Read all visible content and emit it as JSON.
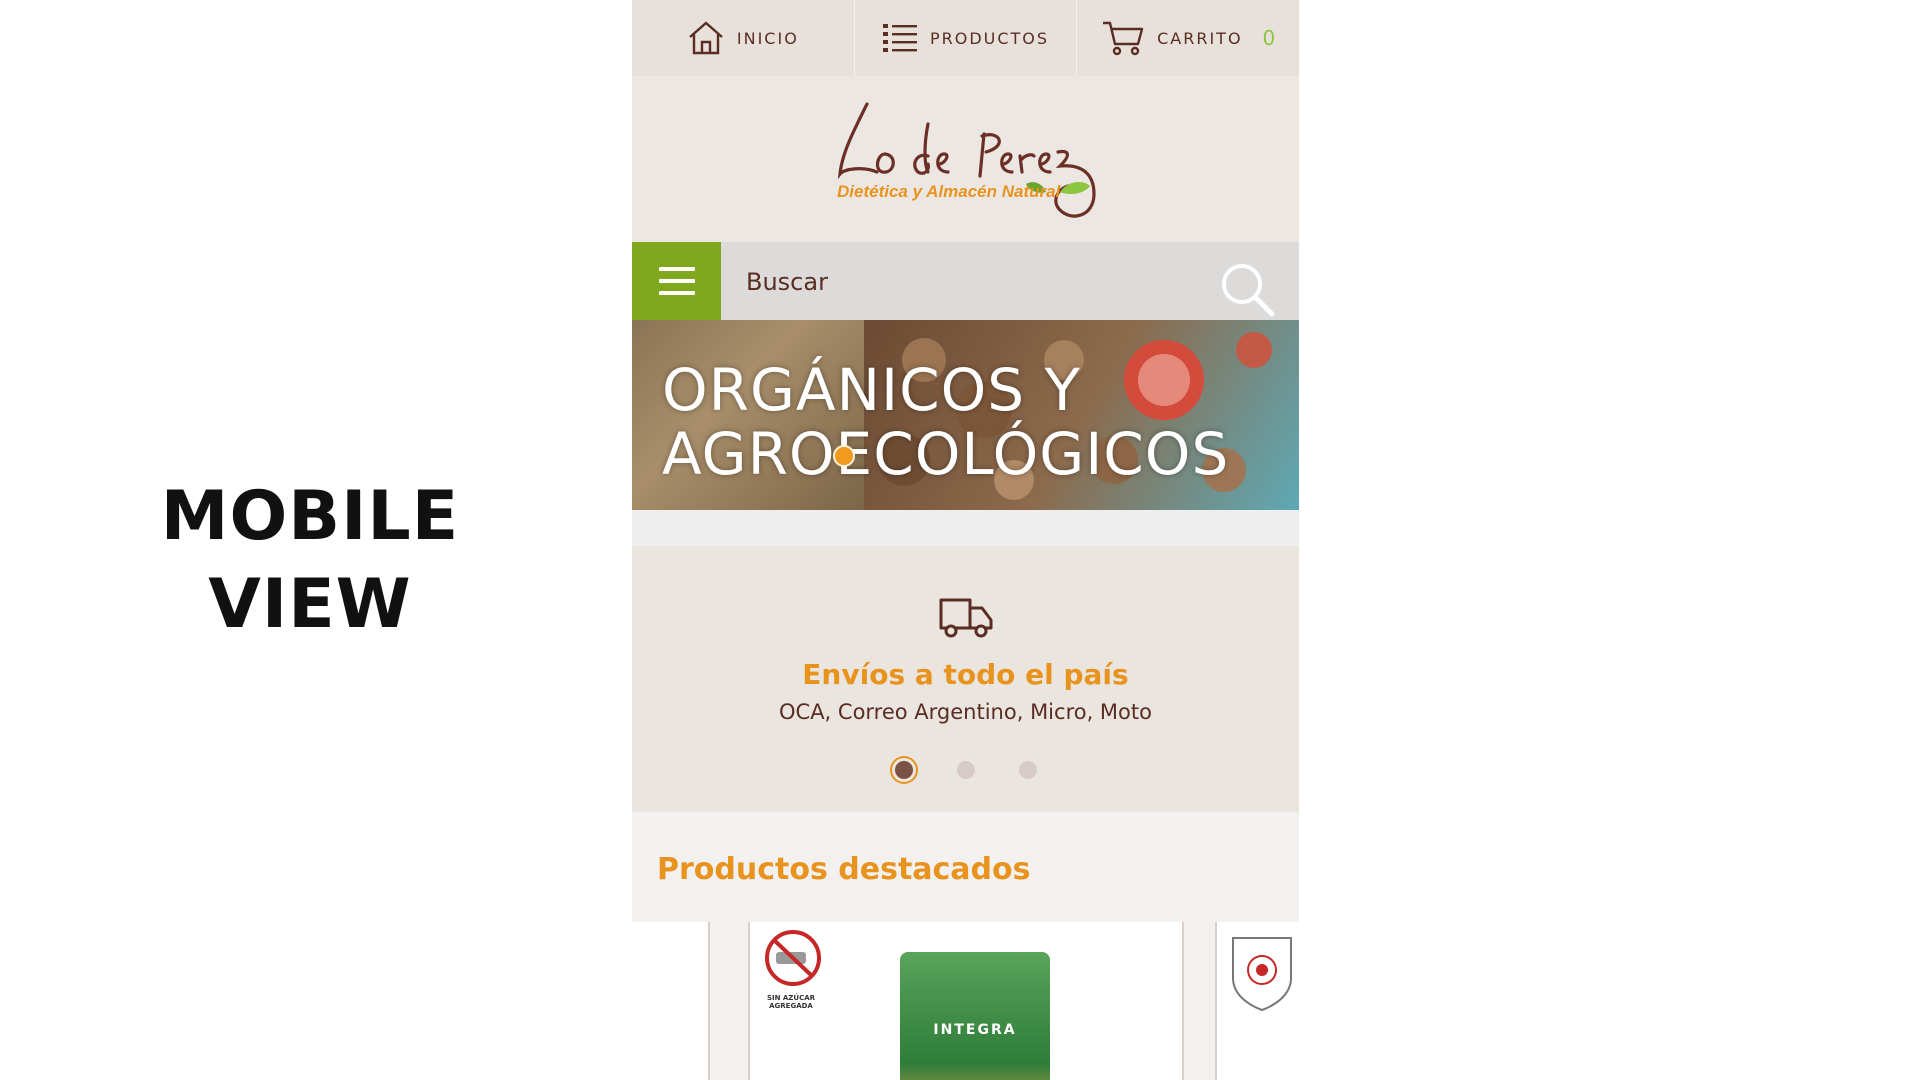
{
  "side_label": {
    "line1": "MOBILE",
    "line2": "VIEW"
  },
  "nav": {
    "home": "INICIO",
    "products": "PRODUCTOS",
    "cart": "CARRITO",
    "cart_count": "0"
  },
  "logo": {
    "brand": "Lo de Perez",
    "tagline": "Dietética y Almacén Natural"
  },
  "search": {
    "placeholder": "Buscar"
  },
  "banner": {
    "line1": "ORGÁNICOS Y",
    "line2": "AGROECOLÓGICOS"
  },
  "shipping": {
    "title": "Envíos a todo el país",
    "subtitle": "OCA, Correo Argentino, Micro, Moto",
    "active_slide": 1,
    "slide_count": 3
  },
  "featured": {
    "title": "Productos destacados",
    "products": [
      {
        "badge": "SIN AZÚCAR AGREGADA",
        "package_label": "INTEGRA"
      }
    ]
  },
  "colors": {
    "accent_orange": "#e8931e",
    "accent_green": "#7fa81f",
    "brown_text": "#5a2d22",
    "cart_count": "#8cc63f"
  }
}
